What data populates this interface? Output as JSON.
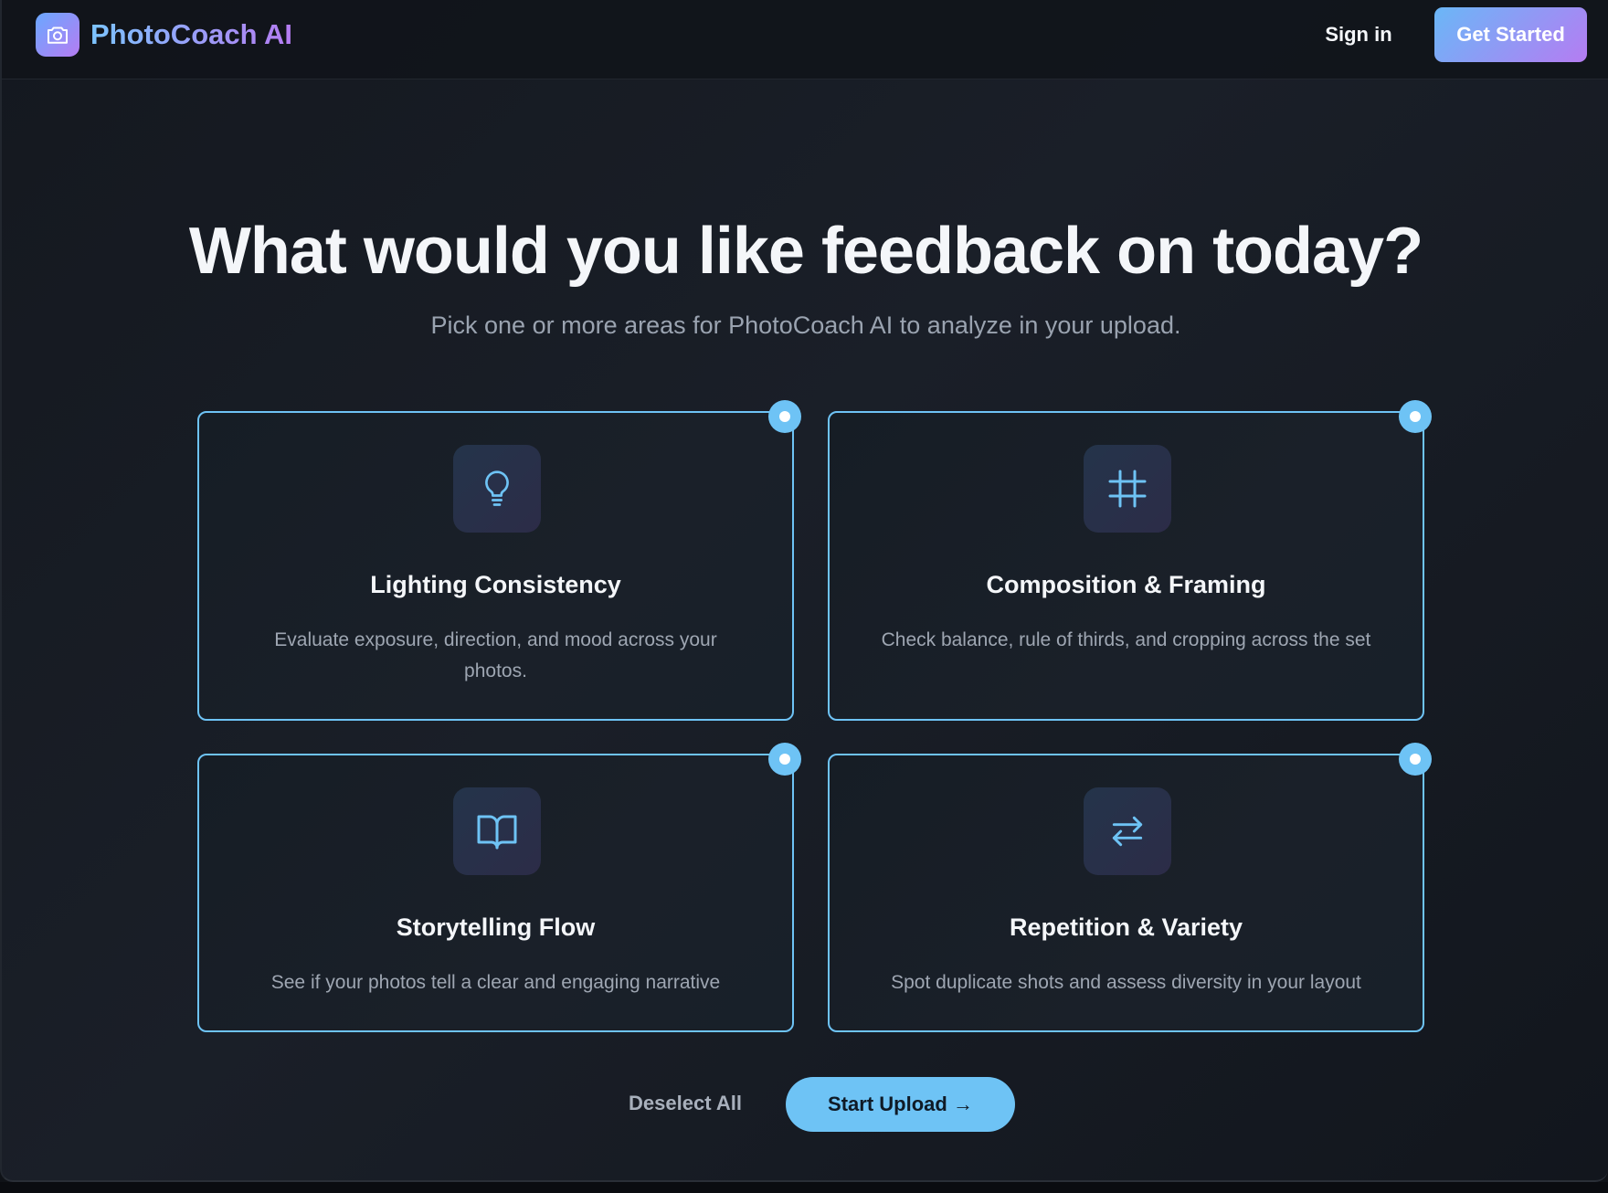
{
  "header": {
    "brand": "PhotoCoach AI",
    "signin_label": "Sign in",
    "get_started_label": "Get Started"
  },
  "hero": {
    "title": "What would you like feedback on today?",
    "subtitle": "Pick one or more areas for PhotoCoach AI to analyze in your upload."
  },
  "options": [
    {
      "title": "Lighting Consistency",
      "description": "Evaluate exposure, direction, and mood across your photos.",
      "icon": "lightbulb-icon",
      "selected": true
    },
    {
      "title": "Composition & Framing",
      "description": "Check balance, rule of thirds, and cropping across the set",
      "icon": "crop-frame-icon",
      "selected": true
    },
    {
      "title": "Storytelling Flow",
      "description": "See if your photos tell a clear and engaging narrative",
      "icon": "book-open-icon",
      "selected": true
    },
    {
      "title": "Repetition & Variety",
      "description": "Spot duplicate shots and assess diversity in your layout",
      "icon": "arrows-swap-icon",
      "selected": true
    }
  ],
  "actions": {
    "deselect_label": "Deselect All",
    "upload_label": "Start Upload →"
  },
  "colors": {
    "accent": "#6ec3f5",
    "brand_gradient_start": "#6ab7f7",
    "brand_gradient_end": "#b57cf2",
    "background": "#14181f"
  }
}
